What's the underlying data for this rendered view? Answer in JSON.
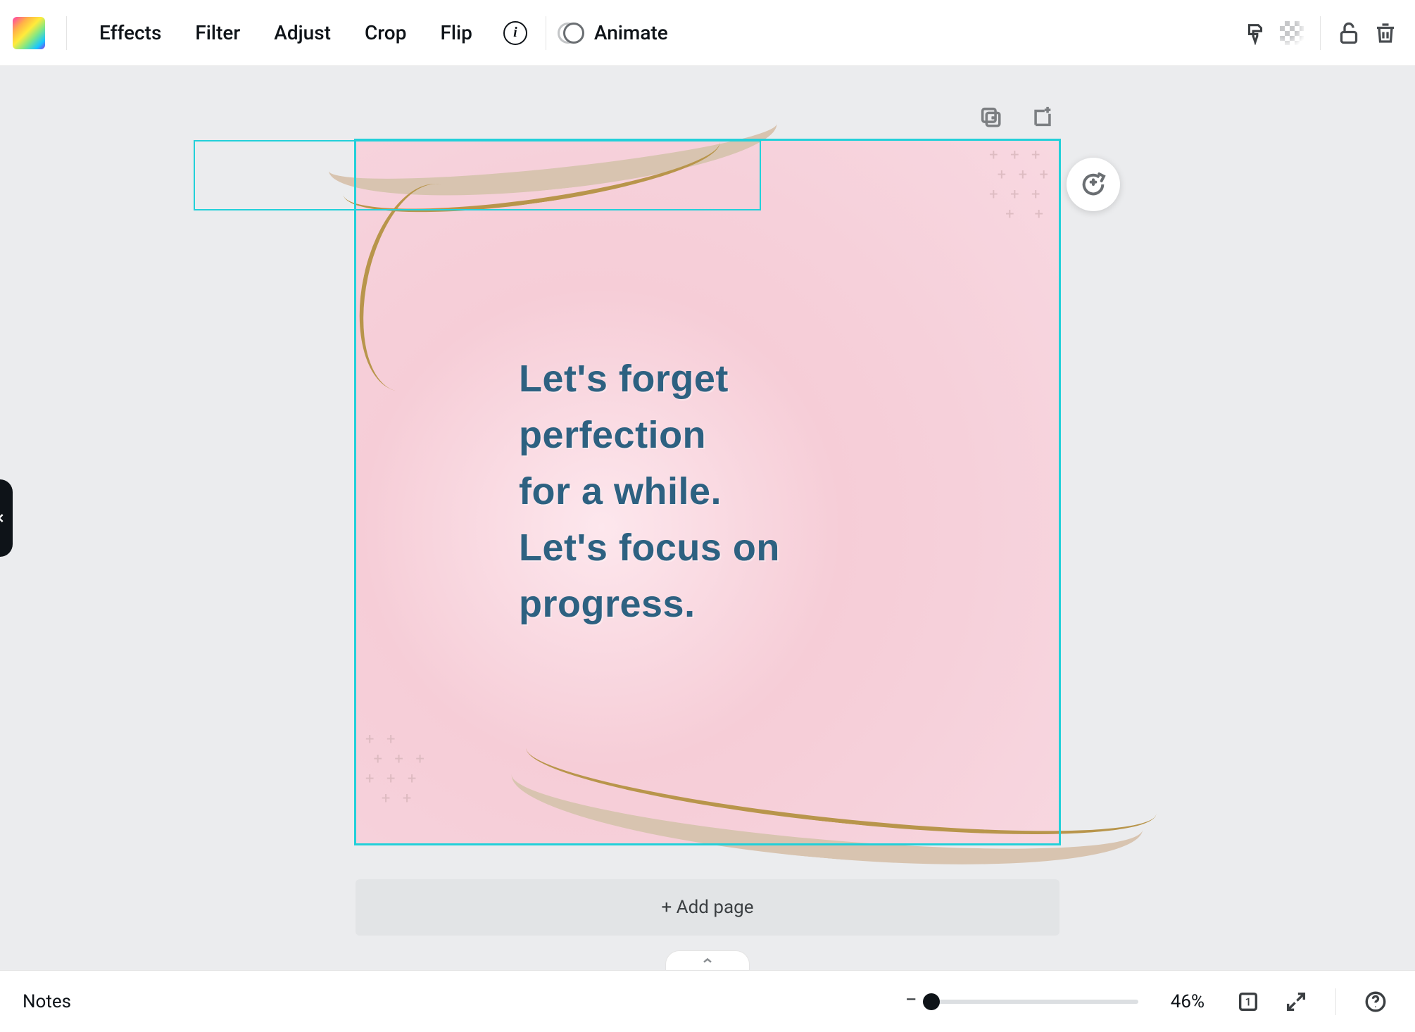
{
  "toolbar": {
    "effects": "Effects",
    "filter": "Filter",
    "adjust": "Adjust",
    "crop": "Crop",
    "flip": "Flip",
    "animate": "Animate"
  },
  "canvas": {
    "quote_l1": "Let's forget",
    "quote_l2": "perfection",
    "quote_l3": "for a while.",
    "quote_l4": "Let's focus on",
    "quote_l5": "progress.",
    "add_page_label": "+ Add page"
  },
  "footer": {
    "notes_label": "Notes",
    "zoom_value": "46%",
    "page_count": "1"
  }
}
